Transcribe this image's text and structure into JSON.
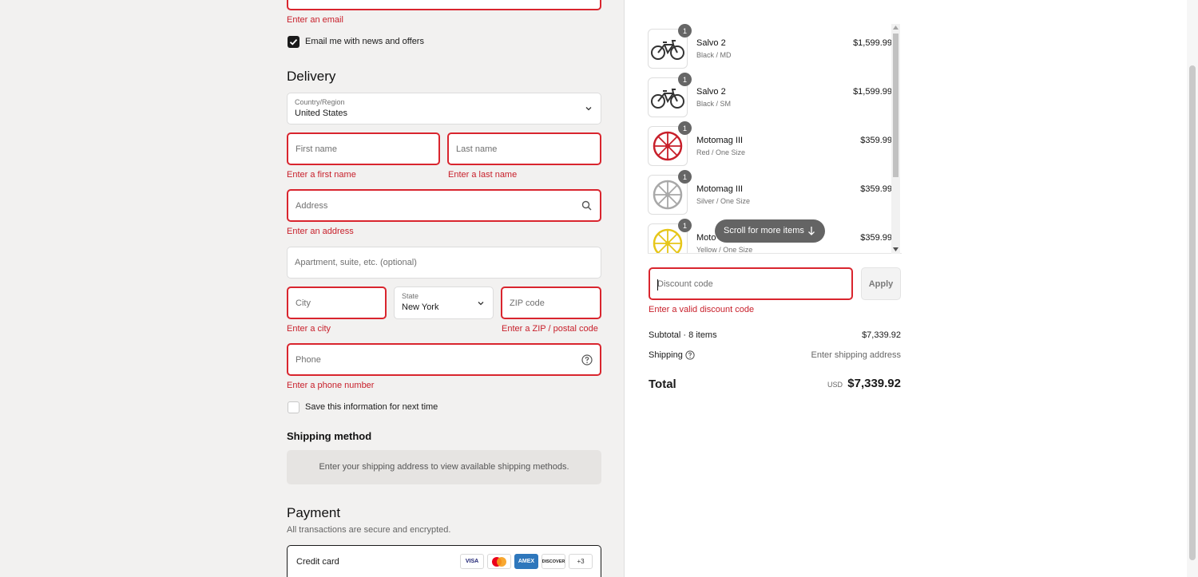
{
  "contact": {
    "email_error": "Enter an email",
    "newsletter_label": "Email me with news and offers"
  },
  "delivery": {
    "heading": "Delivery",
    "country_label": "Country/Region",
    "country_value": "United States",
    "first_name_placeholder": "First name",
    "first_name_error": "Enter a first name",
    "last_name_placeholder": "Last name",
    "last_name_error": "Enter a last name",
    "address_placeholder": "Address",
    "address_error": "Enter an address",
    "apartment_placeholder": "Apartment, suite, etc. (optional)",
    "city_placeholder": "City",
    "city_error": "Enter a city",
    "state_label": "State",
    "state_value": "New York",
    "zip_placeholder": "ZIP code",
    "zip_error": "Enter a ZIP / postal code",
    "phone_placeholder": "Phone",
    "phone_error": "Enter a phone number",
    "save_info_label": "Save this information for next time"
  },
  "shipping_method": {
    "heading": "Shipping method",
    "notice": "Enter your shipping address to view available shipping methods."
  },
  "payment": {
    "heading": "Payment",
    "subtitle": "All transactions are secure and encrypted.",
    "credit_card_label": "Credit card",
    "cards": [
      "VISA",
      "MC",
      "AMEX",
      "DISCOVER"
    ],
    "more_cards": "+3"
  },
  "summary": {
    "items": [
      {
        "qty": "1",
        "name": "Salvo 2",
        "variant": "Black / MD",
        "price": "$1,599.99",
        "color": "#333333"
      },
      {
        "qty": "1",
        "name": "Salvo 2",
        "variant": "Black / SM",
        "price": "$1,599.99",
        "color": "#333333"
      },
      {
        "qty": "1",
        "name": "Motomag III",
        "variant": "Red / One Size",
        "price": "$359.99",
        "color": "#c8202b"
      },
      {
        "qty": "1",
        "name": "Motomag III",
        "variant": "Silver / One Size",
        "price": "$359.99",
        "color": "#a8a8a8"
      },
      {
        "qty": "1",
        "name": "Moto",
        "variant": "Yellow / One Size",
        "price": "$359.99",
        "color": "#e6c619"
      }
    ],
    "scroll_hint": "Scroll for more items",
    "discount_placeholder": "Discount code",
    "discount_error": "Enter a valid discount code",
    "apply_label": "Apply",
    "subtotal_label": "Subtotal · 8 items",
    "subtotal_value": "$7,339.92",
    "shipping_label": "Shipping",
    "shipping_value": "Enter shipping address",
    "total_label": "Total",
    "currency": "USD",
    "total_value": "$7,339.92"
  },
  "colors": {
    "error": "#c8202b",
    "accent": "#1a1a1a"
  }
}
